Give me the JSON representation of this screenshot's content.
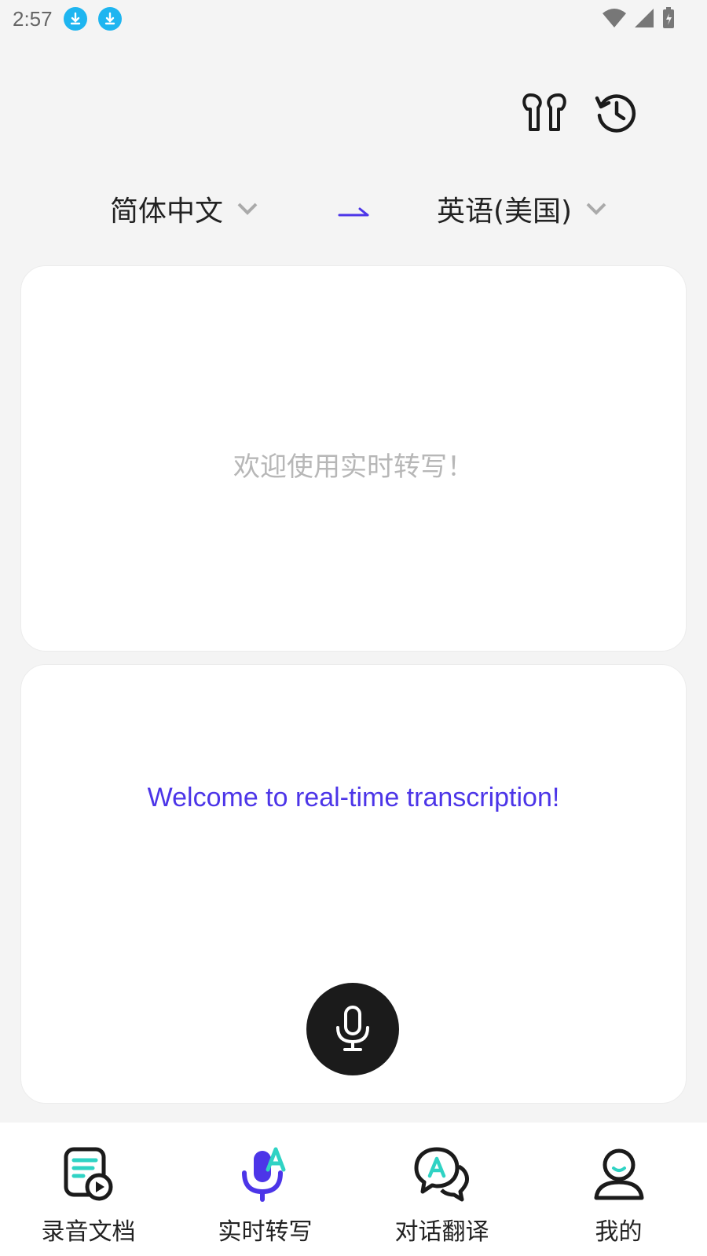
{
  "status_bar": {
    "time": "2:57"
  },
  "languages": {
    "source": "简体中文",
    "target": "英语(美国)"
  },
  "source_panel": {
    "message": "欢迎使用实时转写！"
  },
  "target_panel": {
    "message": "Welcome to real-time transcription!"
  },
  "tabs": [
    {
      "label": "录音文档",
      "icon": "recording-docs-icon"
    },
    {
      "label": "实时转写",
      "icon": "realtime-transcribe-icon",
      "active": true
    },
    {
      "label": "对话翻译",
      "icon": "dialog-translate-icon"
    },
    {
      "label": "我的",
      "icon": "profile-icon"
    }
  ],
  "colors": {
    "accent": "#4c35e8",
    "teal": "#2fd3c4",
    "download_badge": "#1eb5f0"
  }
}
